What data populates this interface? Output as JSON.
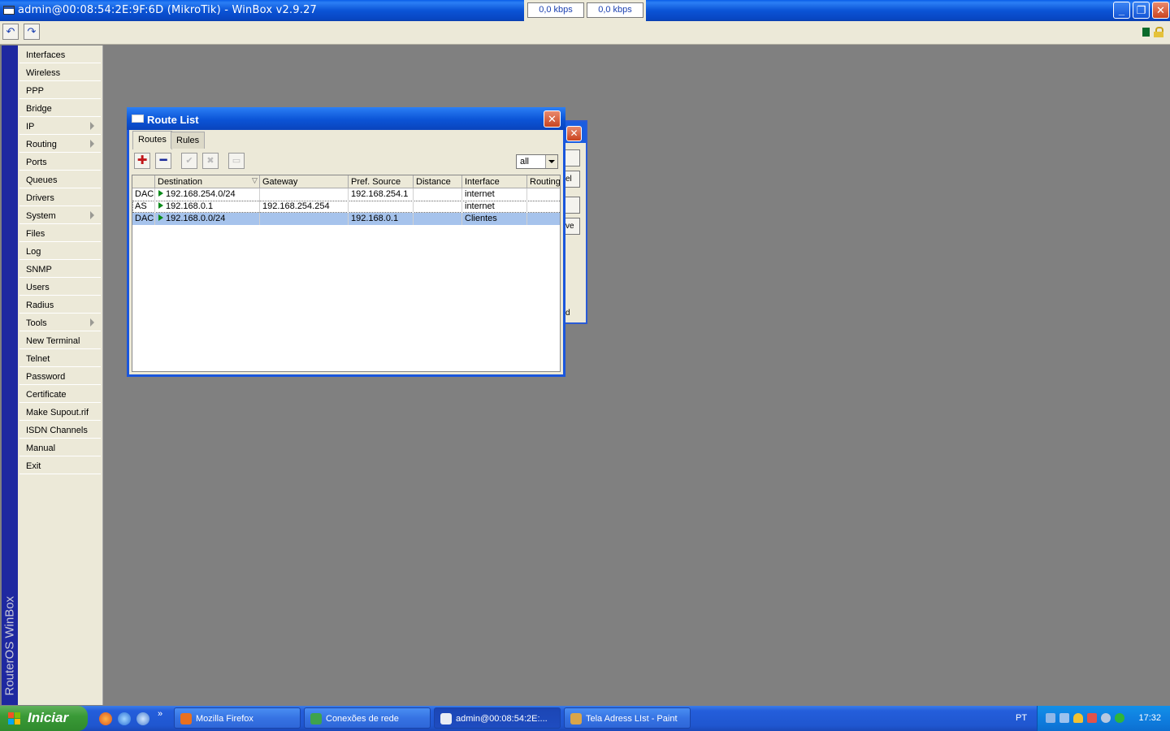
{
  "window": {
    "title": "admin@00:08:54:2E:9F:6D (MikroTik) - WinBox v2.9.27",
    "tx_rate": "0,0 kbps",
    "rx_rate": "0,0 kbps"
  },
  "brand": "RouterOS WinBox",
  "menu": [
    {
      "label": "Interfaces",
      "submenu": false
    },
    {
      "label": "Wireless",
      "submenu": false
    },
    {
      "label": "PPP",
      "submenu": false
    },
    {
      "label": "Bridge",
      "submenu": false
    },
    {
      "label": "IP",
      "submenu": true
    },
    {
      "label": "Routing",
      "submenu": true
    },
    {
      "label": "Ports",
      "submenu": false
    },
    {
      "label": "Queues",
      "submenu": false
    },
    {
      "label": "Drivers",
      "submenu": false
    },
    {
      "label": "System",
      "submenu": true
    },
    {
      "label": "Files",
      "submenu": false
    },
    {
      "label": "Log",
      "submenu": false
    },
    {
      "label": "SNMP",
      "submenu": false
    },
    {
      "label": "Users",
      "submenu": false
    },
    {
      "label": "Radius",
      "submenu": false
    },
    {
      "label": "Tools",
      "submenu": true
    },
    {
      "label": "New Terminal",
      "submenu": false
    },
    {
      "label": "Telnet",
      "submenu": false
    },
    {
      "label": "Password",
      "submenu": false
    },
    {
      "label": "Certificate",
      "submenu": false
    },
    {
      "label": "Make Supout.rif",
      "submenu": false
    },
    {
      "label": "ISDN Channels",
      "submenu": false
    },
    {
      "label": "Manual",
      "submenu": false
    },
    {
      "label": "Exit",
      "submenu": false
    }
  ],
  "bg_window": {
    "fragments": [
      "el",
      "ve",
      "d"
    ]
  },
  "route_list": {
    "title": "Route List",
    "tabs": [
      "Routes",
      "Rules"
    ],
    "filter": "all",
    "columns": [
      "",
      "Destination",
      "Gateway",
      "Pref. Source",
      "Distance",
      "Interface",
      "Routing"
    ],
    "rows": [
      {
        "flags": "DAC",
        "destination": "192.168.254.0/24",
        "gateway": "",
        "pref_source": "192.168.254.1",
        "distance": "",
        "interface": "internet",
        "routing": "",
        "selected": false
      },
      {
        "flags": "AS",
        "destination": "192.168.0.1",
        "gateway": "192.168.254.254",
        "pref_source": "",
        "distance": "",
        "interface": "internet",
        "routing": "",
        "selected": false
      },
      {
        "flags": "DAC",
        "destination": "192.168.0.0/24",
        "gateway": "",
        "pref_source": "192.168.0.1",
        "distance": "",
        "interface": "Clientes",
        "routing": "",
        "selected": true
      }
    ]
  },
  "taskbar": {
    "start_label": "Iniciar",
    "tasks": [
      {
        "label": "Mozilla Firefox",
        "active": false
      },
      {
        "label": "Conexões de rede",
        "active": false
      },
      {
        "label": "admin@00:08:54:2E:...",
        "active": true
      },
      {
        "label": "Tela Adress LIst - Paint",
        "active": false
      }
    ],
    "language": "PT",
    "clock": "17:32"
  },
  "colors": {
    "accent": "#0b54d6",
    "selection": "#a6c3ec",
    "brand_strip": "#1e28a0"
  }
}
